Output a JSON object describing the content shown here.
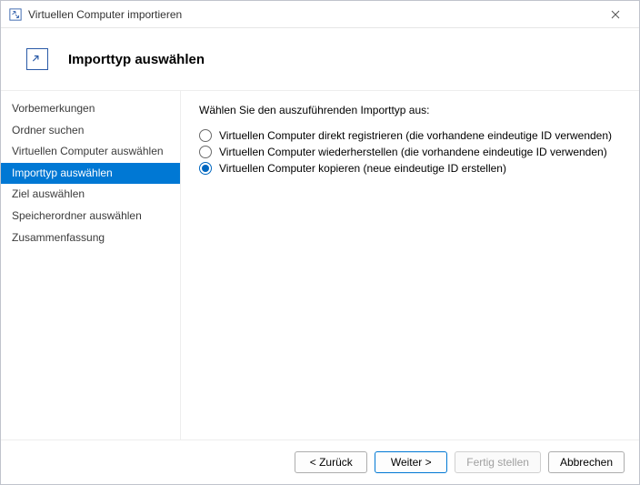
{
  "window": {
    "title": "Virtuellen Computer importieren"
  },
  "header": {
    "heading": "Importtyp auswählen"
  },
  "sidebar": {
    "items": [
      {
        "label": "Vorbemerkungen",
        "selected": false
      },
      {
        "label": "Ordner suchen",
        "selected": false
      },
      {
        "label": "Virtuellen Computer auswählen",
        "selected": false
      },
      {
        "label": "Importtyp auswählen",
        "selected": true
      },
      {
        "label": "Ziel auswählen",
        "selected": false
      },
      {
        "label": "Speicherordner auswählen",
        "selected": false
      },
      {
        "label": "Zusammenfassung",
        "selected": false
      }
    ]
  },
  "content": {
    "prompt": "Wählen Sie den auszuführenden Importtyp aus:",
    "options": [
      {
        "label": "Virtuellen Computer direkt registrieren (die vorhandene eindeutige ID verwenden)",
        "selected": false
      },
      {
        "label": "Virtuellen Computer wiederherstellen (die vorhandene eindeutige ID verwenden)",
        "selected": false
      },
      {
        "label": "Virtuellen Computer kopieren (neue eindeutige ID erstellen)",
        "selected": true
      }
    ]
  },
  "footer": {
    "back": "< Zurück",
    "next": "Weiter >",
    "finish": "Fertig stellen",
    "cancel": "Abbrechen"
  }
}
